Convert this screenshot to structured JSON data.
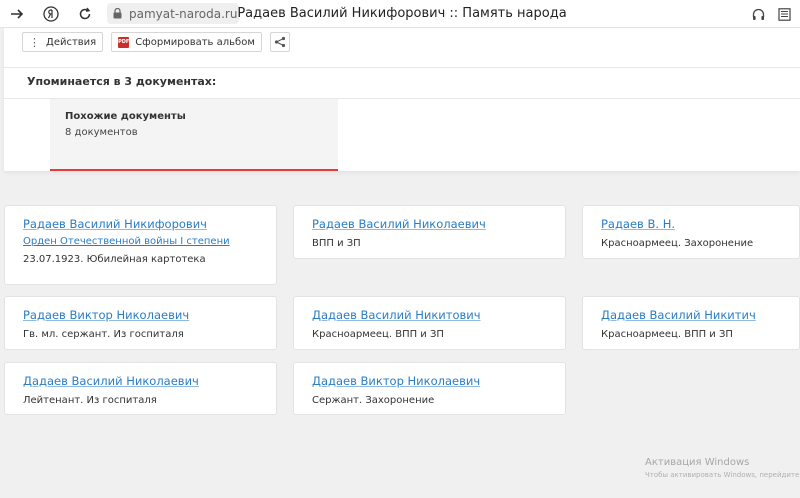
{
  "browser": {
    "url": "pamyat-naroda.ru",
    "title": "Радаев Василий Никифорович :: Память народа"
  },
  "toolbar": {
    "actions_label": "Действия",
    "album_label": "Сформировать альбом",
    "pdf_icon_text": "PDF"
  },
  "section": {
    "mentioned_title": "Упоминается в 3 документах:"
  },
  "similar": {
    "title": "Похожие документы",
    "count": "8 документов"
  },
  "cards": [
    {
      "name": "Радаев Василий Никифорович",
      "award": "Орден Отечественной войны I степени",
      "desc": "23.07.1923. Юбилейная картотека"
    },
    {
      "name": "Радаев Василий Николаевич",
      "desc": "ВПП и ЗП"
    },
    {
      "name": "Радаев В. Н.",
      "desc": "Красноармеец. Захоронение"
    },
    {
      "name": "Радаев Виктор Николаевич",
      "desc": "Гв. мл. сержант. Из госпиталя"
    },
    {
      "name": "Дадаев Василий Никитович",
      "desc": "Красноармеец. ВПП и ЗП"
    },
    {
      "name": "Дадаев Василий Никитич",
      "desc": "Красноармеец. ВПП и ЗП"
    },
    {
      "name": "Дадаев Василий Николаевич",
      "desc": "Лейтенант. Из госпиталя"
    },
    {
      "name": "Дадаев Виктор Николаевич",
      "desc": "Сержант. Захоронение"
    }
  ],
  "watermark": {
    "line1": "Активация Windows",
    "line2": "Чтобы активировать Windows, перейдите в"
  },
  "colors": {
    "link": "#2a7dc4",
    "accent": "#e53b3b"
  }
}
